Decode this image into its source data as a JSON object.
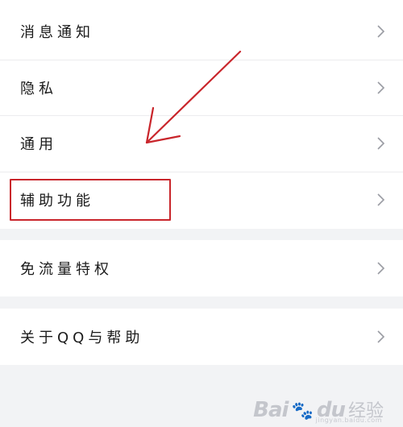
{
  "menu": {
    "group1": [
      {
        "label": "消息通知"
      },
      {
        "label": "隐私"
      },
      {
        "label": "通用"
      },
      {
        "label": "辅助功能"
      }
    ],
    "group2": [
      {
        "label": "免流量特权"
      }
    ],
    "group3": [
      {
        "label": "关于QQ与帮助"
      }
    ]
  },
  "annotation": {
    "highlight_color": "#c9252b",
    "arrow_color": "#c9252b"
  },
  "watermark": {
    "brand": "Bai",
    "paw": "🐾",
    "brand_suffix": "du",
    "sub": "经验",
    "url": "jingyan.baidu.com"
  },
  "icons": {
    "chevron": "chevron-right-icon"
  }
}
